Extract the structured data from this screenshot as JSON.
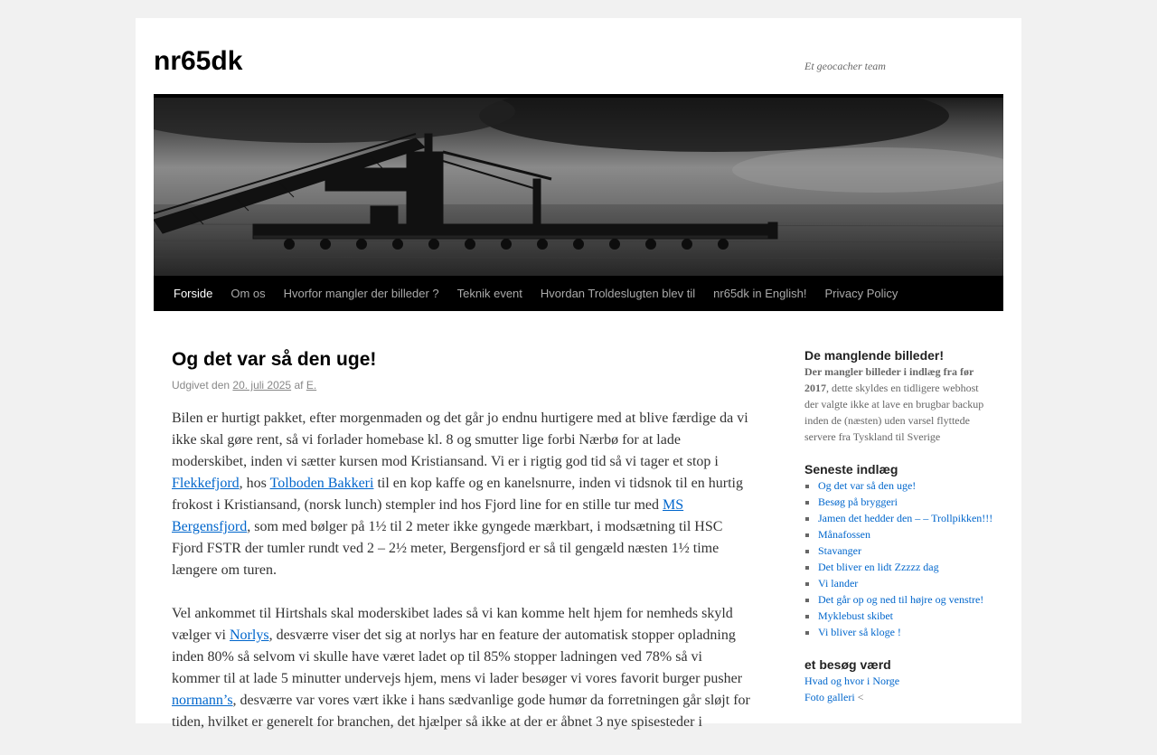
{
  "site": {
    "title": "nr65dk",
    "description": "Et geocacher team"
  },
  "nav": [
    {
      "label": "Forside",
      "current": true
    },
    {
      "label": "Om os"
    },
    {
      "label": "Hvorfor mangler der billeder ?"
    },
    {
      "label": "Teknik event"
    },
    {
      "label": "Hvordan Troldeslugten blev til"
    },
    {
      "label": "nr65dk in English!"
    },
    {
      "label": "Privacy Policy"
    }
  ],
  "post": {
    "title": "Og det var så den uge!",
    "meta_prefix": "Udgivet den",
    "date": "20. juli 2025",
    "meta_by": "af",
    "author": "E.",
    "p1": {
      "t1": "Bilen er hurtigt pakket, efter morgenmaden og det går jo endnu hurtigere med at blive færdige da vi ikke skal gøre rent, så vi forlader homebase kl. 8 og smutter lige forbi Nærbø for at lade moderskibet, inden vi sætter kursen mod Kristiansand. Vi er i rigtig god tid så vi tager et stop i ",
      "l1": "Flekkefjord",
      "t2": ", hos ",
      "l2": "Tolboden Bakkeri",
      "t3": " til en kop kaffe og en kanelsnurre, inden vi tidsnok til en hurtig frokost i Kristiansand, (norsk lunch) stempler ind hos Fjord line for en stille tur med ",
      "l3": "MS Bergensfjord",
      "t4": ", som med bølger på 1½ til 2 meter ikke gyngede mærkbart, i modsætning til HSC Fjord FSTR der tumler rundt ved 2 – 2½ meter, Bergensfjord er så til gengæld næsten 1½ time længere om turen."
    },
    "p2": {
      "t1": "Vel ankommet til Hirtshals skal moderskibet lades så vi kan komme helt hjem for nemheds skyld vælger vi ",
      "l1": "Norlys",
      "t2": ", desværre viser det sig at norlys har en feature der automatisk stopper opladning inden 80% så selvom vi skulle have været ladet op til 85% stopper ladningen ved 78% så vi kommer til at lade 5 minutter undervejs hjem, mens vi lader besøger vi vores favorit burger pusher ",
      "l2": "normann’s",
      "t3": ", desværre var vores vært ikke i hans sædvanlige gode humør da forretningen går sløjt for tiden, hvilket er generelt for branchen, det hjælper så ikke at der er åbnet 3 nye spisesteder i"
    }
  },
  "sidebar": {
    "missing": {
      "title": "De manglende billeder!",
      "bold": "Der mangler billeder i indlæg fra før 2017",
      "text": ", dette skyldes en tidligere webhost der valgte ikke at lave en brugbar backup inden de (næsten) uden varsel flyttede servere fra Tyskland til Sverige"
    },
    "recent": {
      "title": "Seneste indlæg",
      "items": [
        "Og det var så den uge!",
        "Besøg på bryggeri",
        "Jamen det hedder den – – Trollpikken!!!",
        "Månafossen",
        "Stavanger",
        "Det bliver en lidt Zzzzz dag",
        "Vi lander",
        "Det går op og ned til højre og venstre!",
        "Myklebust skibet",
        "Vi bliver så kloge !"
      ]
    },
    "visit": {
      "title": "et besøg værd",
      "links": [
        "Hvad og hvor i Norge",
        "Foto galleri"
      ],
      "suffix": " <"
    }
  }
}
